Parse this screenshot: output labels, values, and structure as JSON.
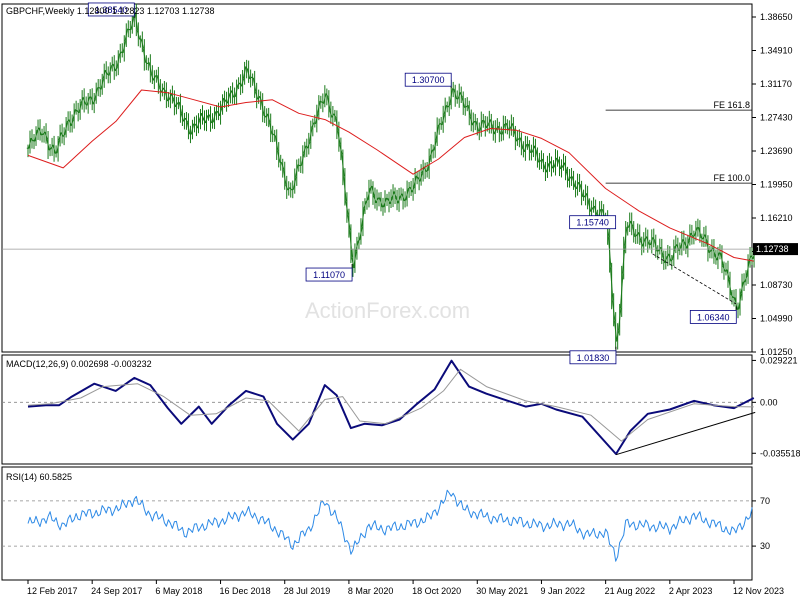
{
  "chart_data": [
    {
      "type": "candlestick",
      "title": "GBPCHF,Weekly  1.12800 1.12823 1.12703 1.12738",
      "watermark": "ActionForex.com",
      "ylim": [
        1.0125,
        1.401
      ],
      "y_ticks": [
        "1.38650",
        "1.34910",
        "1.31170",
        "1.27430",
        "1.23690",
        "1.19950",
        "1.16210",
        "1.12470",
        "1.08730",
        "1.04990",
        "1.01250"
      ],
      "x_ticks": [
        "12 Feb 2017",
        "24 Sep 2017",
        "6 May 2018",
        "16 Dec 2018",
        "28 Jul 2019",
        "8 Mar 2020",
        "18 Oct 2020",
        "30 May 2021",
        "9 Jan 2022",
        "21 Aug 2022",
        "2 Apr 2023",
        "12 Nov 2023"
      ],
      "price_anchors": [
        [
          "2017-02-12",
          1.24
        ],
        [
          "2017-04-01",
          1.262
        ],
        [
          "2017-05-15",
          1.232
        ],
        [
          "2017-07-01",
          1.272
        ],
        [
          "2017-09-24",
          1.298
        ],
        [
          "2017-12-15",
          1.336
        ],
        [
          "2018-02-18",
          1.3854
        ],
        [
          "2018-04-15",
          1.32
        ],
        [
          "2018-06-15",
          1.3
        ],
        [
          "2018-09-01",
          1.262
        ],
        [
          "2018-12-16",
          1.283
        ],
        [
          "2019-03-15",
          1.325
        ],
        [
          "2019-05-01",
          1.296
        ],
        [
          "2019-07-10",
          1.228
        ],
        [
          "2019-08-15",
          1.187
        ],
        [
          "2019-10-20",
          1.255
        ],
        [
          "2019-12-15",
          1.299
        ],
        [
          "2020-01-25",
          1.268
        ],
        [
          "2020-03-19",
          1.1107
        ],
        [
          "2020-05-15",
          1.192
        ],
        [
          "2020-07-15",
          1.178
        ],
        [
          "2020-10-18",
          1.195
        ],
        [
          "2020-12-15",
          1.23
        ],
        [
          "2021-02-10",
          1.286
        ],
        [
          "2021-02-28",
          1.307
        ],
        [
          "2021-05-30",
          1.265
        ],
        [
          "2021-09-15",
          1.262
        ],
        [
          "2022-01-09",
          1.224
        ],
        [
          "2022-04-01",
          1.218
        ],
        [
          "2022-06-01",
          1.186
        ],
        [
          "2022-08-21",
          1.16
        ],
        [
          "2022-09-26",
          1.0183
        ],
        [
          "2022-10-30",
          1.153
        ],
        [
          "2023-01-15",
          1.135
        ],
        [
          "2023-04-02",
          1.117
        ],
        [
          "2023-06-25",
          1.148
        ],
        [
          "2023-09-20",
          1.119
        ],
        [
          "2023-11-20",
          1.0634
        ],
        [
          "2024-01-20",
          1.127
        ]
      ],
      "series": [
        {
          "name": "MA",
          "color": "#dd1d1d",
          "values": [
            [
              "2017-02-12",
              1.232
            ],
            [
              "2017-06-15",
              1.218
            ],
            [
              "2017-09-24",
              1.248
            ],
            [
              "2017-12-16",
              1.27
            ],
            [
              "2018-03-15",
              1.305
            ],
            [
              "2018-06-15",
              1.302
            ],
            [
              "2018-09-15",
              1.294
            ],
            [
              "2018-12-16",
              1.286
            ],
            [
              "2019-03-15",
              1.291
            ],
            [
              "2019-06-15",
              1.294
            ],
            [
              "2019-09-15",
              1.279
            ],
            [
              "2019-12-16",
              1.272
            ],
            [
              "2020-03-08",
              1.258
            ],
            [
              "2020-06-15",
              1.238
            ],
            [
              "2020-10-18",
              1.211
            ],
            [
              "2021-01-15",
              1.228
            ],
            [
              "2021-04-15",
              1.252
            ],
            [
              "2021-07-15",
              1.262
            ],
            [
              "2021-10-15",
              1.26
            ],
            [
              "2022-01-09",
              1.251
            ],
            [
              "2022-04-15",
              1.235
            ],
            [
              "2022-08-21",
              1.195
            ],
            [
              "2022-12-15",
              1.17
            ],
            [
              "2023-04-02",
              1.151
            ],
            [
              "2023-08-15",
              1.133
            ],
            [
              "2023-11-12",
              1.118
            ],
            [
              "2024-01-20",
              1.114
            ]
          ]
        }
      ],
      "annotations": [
        {
          "label": "1.38540",
          "date": "2018-02-18",
          "value": 1.3854,
          "side": "above"
        },
        {
          "label": "1.30700",
          "date": "2021-02-28",
          "value": 1.307,
          "side": "above"
        },
        {
          "label": "1.11070",
          "date": "2020-03-19",
          "value": 1.1107,
          "side": "below"
        },
        {
          "label": "1.15740",
          "date": "2022-08-21",
          "value": 1.1574,
          "side": "at"
        },
        {
          "label": "1.06340",
          "date": "2023-11-20",
          "value": 1.0634,
          "side": "below"
        },
        {
          "label": "1.01830",
          "date": "2022-09-26",
          "value": 1.0183,
          "side": "below"
        }
      ],
      "levels": [
        {
          "label": "FE 161.8",
          "value": 1.2825,
          "from": "2022-08-21"
        },
        {
          "label": "FE 100.0",
          "value": 1.201,
          "from": "2022-08-21"
        }
      ],
      "current": {
        "label": "1.12738",
        "value": 1.12738
      },
      "trend_lines": [
        {
          "from": [
            "2023-02-01",
            1.122
          ],
          "to": [
            "2023-11-20",
            1.066
          ]
        }
      ]
    },
    {
      "type": "line",
      "title": "MACD(12,26,9) 0.002698 -0.003232",
      "ylim": [
        -0.043,
        0.033
      ],
      "y_tick_labels": [
        {
          "label": "0.029221",
          "value": 0.029221
        },
        {
          "label": "0.00",
          "value": 0.0
        },
        {
          "label": "-0.035518",
          "value": -0.035518
        }
      ],
      "zero_line": 0.0,
      "series": [
        {
          "name": "MACD",
          "color": "#0b0b7a",
          "values": [
            [
              "2017-02-12",
              -0.003
            ],
            [
              "2017-04-15",
              -0.002
            ],
            [
              "2017-06-01",
              -0.002
            ],
            [
              "2017-07-15",
              0.004
            ],
            [
              "2017-10-01",
              0.013
            ],
            [
              "2017-12-15",
              0.008
            ],
            [
              "2018-02-18",
              0.017
            ],
            [
              "2018-04-15",
              0.012
            ],
            [
              "2018-06-15",
              -0.004
            ],
            [
              "2018-08-01",
              -0.015
            ],
            [
              "2018-10-01",
              -0.003
            ],
            [
              "2018-11-15",
              -0.015
            ],
            [
              "2019-01-15",
              -0.002
            ],
            [
              "2019-03-15",
              0.008
            ],
            [
              "2019-05-15",
              0.004
            ],
            [
              "2019-07-01",
              -0.015
            ],
            [
              "2019-08-25",
              -0.026
            ],
            [
              "2019-10-20",
              -0.015
            ],
            [
              "2019-12-15",
              0.012
            ],
            [
              "2020-01-25",
              0.005
            ],
            [
              "2020-03-15",
              -0.018
            ],
            [
              "2020-05-01",
              -0.015
            ],
            [
              "2020-07-01",
              -0.016
            ],
            [
              "2020-09-01",
              -0.012
            ],
            [
              "2020-11-01",
              -0.001
            ],
            [
              "2021-01-01",
              0.009
            ],
            [
              "2021-03-01",
              0.029
            ],
            [
              "2021-05-01",
              0.011
            ],
            [
              "2021-07-01",
              0.006
            ],
            [
              "2021-09-15",
              0.001
            ],
            [
              "2021-11-15",
              -0.003
            ],
            [
              "2022-01-09",
              -0.001
            ],
            [
              "2022-03-01",
              -0.005
            ],
            [
              "2022-06-01",
              -0.01
            ],
            [
              "2022-09-26",
              -0.036
            ],
            [
              "2022-11-15",
              -0.02
            ],
            [
              "2023-01-15",
              -0.008
            ],
            [
              "2023-04-02",
              -0.005
            ],
            [
              "2023-06-25",
              0.001
            ],
            [
              "2023-09-01",
              -0.002
            ],
            [
              "2023-11-12",
              -0.004
            ],
            [
              "2024-01-20",
              0.003
            ]
          ]
        },
        {
          "name": "Signal",
          "color": "#999999",
          "values": [
            [
              "2017-02-12",
              -0.002
            ],
            [
              "2017-05-01",
              -0.001
            ],
            [
              "2017-08-15",
              0.003
            ],
            [
              "2017-11-01",
              0.011
            ],
            [
              "2018-03-01",
              0.013
            ],
            [
              "2018-06-01",
              0.004
            ],
            [
              "2018-09-01",
              -0.009
            ],
            [
              "2018-12-01",
              -0.008
            ],
            [
              "2019-03-15",
              0.003
            ],
            [
              "2019-06-01",
              0.001
            ],
            [
              "2019-09-15",
              -0.02
            ],
            [
              "2019-12-15",
              0.002
            ],
            [
              "2020-02-15",
              0.004
            ],
            [
              "2020-04-15",
              -0.013
            ],
            [
              "2020-07-15",
              -0.015
            ],
            [
              "2020-11-15",
              -0.004
            ],
            [
              "2021-02-01",
              0.008
            ],
            [
              "2021-04-01",
              0.023
            ],
            [
              "2021-07-01",
              0.011
            ],
            [
              "2021-11-15",
              0.001
            ],
            [
              "2022-03-01",
              -0.003
            ],
            [
              "2022-07-01",
              -0.009
            ],
            [
              "2022-10-15",
              -0.027
            ],
            [
              "2023-01-15",
              -0.012
            ],
            [
              "2023-06-25",
              -0.001
            ],
            [
              "2023-11-12",
              -0.003
            ],
            [
              "2024-01-20",
              -0.0032
            ]
          ]
        }
      ],
      "trend_lines": [
        {
          "from": [
            "2022-09-26",
            -0.0365
          ],
          "to": [
            "2024-01-25",
            -0.007
          ]
        }
      ]
    },
    {
      "type": "line",
      "title": "RSI(14) 60.5825",
      "ylim": [
        0,
        100
      ],
      "y_ticks": [
        "70",
        "30"
      ],
      "levels": [
        70,
        30
      ],
      "series": [
        {
          "name": "RSI",
          "color": "#2e8ae6",
          "values": [
            [
              "2017-02-12",
              50
            ],
            [
              "2017-05-01",
              55
            ],
            [
              "2017-06-15",
              48
            ],
            [
              "2017-08-01",
              57
            ],
            [
              "2017-10-15",
              60
            ],
            [
              "2018-01-01",
              64
            ],
            [
              "2018-02-18",
              72
            ],
            [
              "2018-04-15",
              58
            ],
            [
              "2018-06-15",
              52
            ],
            [
              "2018-08-15",
              42
            ],
            [
              "2018-10-15",
              48
            ],
            [
              "2018-12-16",
              52
            ],
            [
              "2019-03-15",
              60
            ],
            [
              "2019-05-01",
              55
            ],
            [
              "2019-07-01",
              44
            ],
            [
              "2019-08-25",
              31
            ],
            [
              "2019-10-20",
              45
            ],
            [
              "2019-12-15",
              70
            ],
            [
              "2020-01-25",
              55
            ],
            [
              "2020-03-19",
              25
            ],
            [
              "2020-05-15",
              48
            ],
            [
              "2020-07-15",
              45
            ],
            [
              "2020-10-18",
              50
            ],
            [
              "2020-12-15",
              55
            ],
            [
              "2021-02-28",
              78
            ],
            [
              "2021-04-15",
              62
            ],
            [
              "2021-07-15",
              55
            ],
            [
              "2021-10-15",
              52
            ],
            [
              "2022-01-09",
              48
            ],
            [
              "2022-04-15",
              50
            ],
            [
              "2022-06-15",
              40
            ],
            [
              "2022-08-21",
              42
            ],
            [
              "2022-09-26",
              20
            ],
            [
              "2022-11-01",
              50
            ],
            [
              "2023-01-15",
              48
            ],
            [
              "2023-04-02",
              46
            ],
            [
              "2023-06-25",
              57
            ],
            [
              "2023-09-20",
              48
            ],
            [
              "2023-11-12",
              42
            ],
            [
              "2024-01-20",
              60.58
            ]
          ]
        }
      ]
    }
  ]
}
